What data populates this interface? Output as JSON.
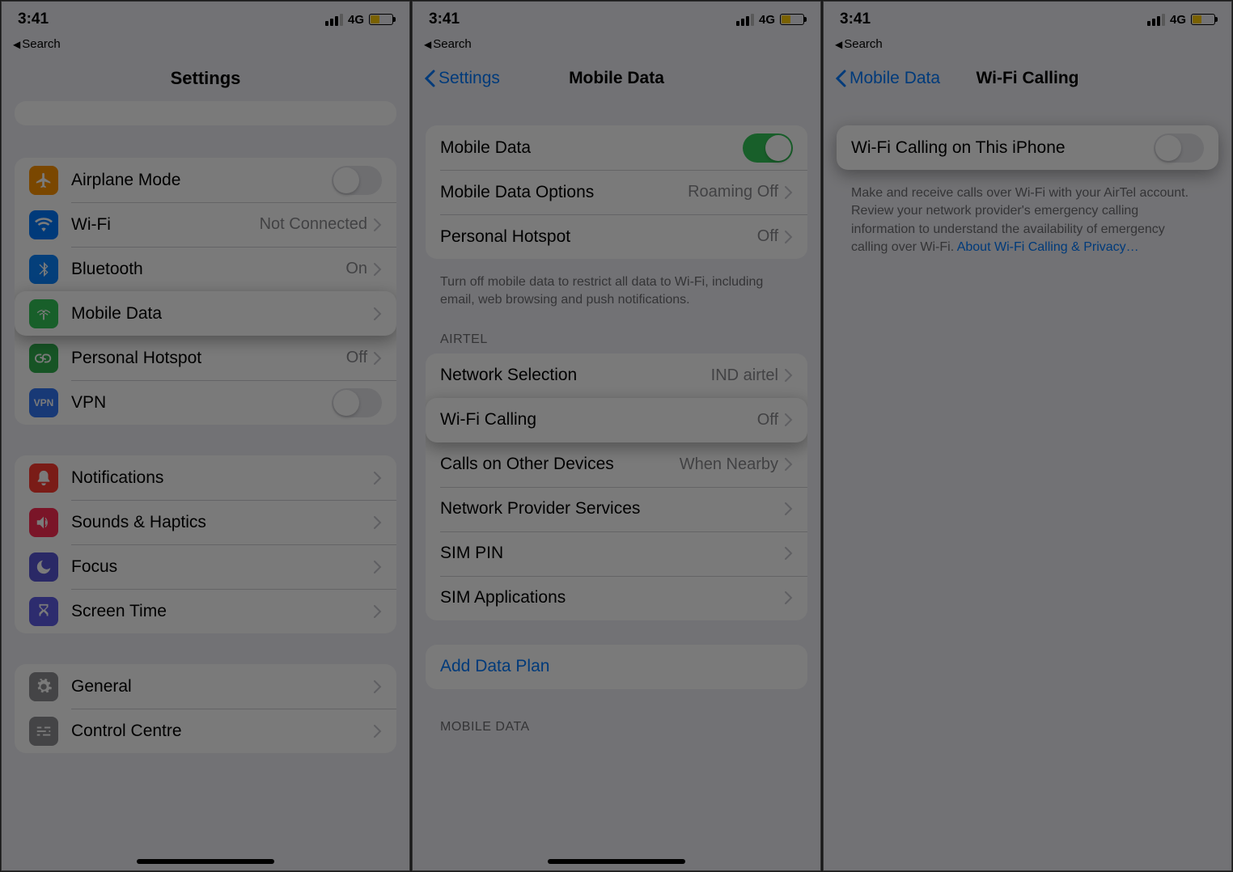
{
  "status": {
    "time": "3:41",
    "network_label": "4G",
    "breadcrumb": "Search"
  },
  "panel1": {
    "title": "Settings",
    "rows": {
      "airplane": "Airplane Mode",
      "wifi": {
        "label": "Wi-Fi",
        "value": "Not Connected"
      },
      "bluetooth": {
        "label": "Bluetooth",
        "value": "On"
      },
      "mobile_data": "Mobile Data",
      "hotspot": {
        "label": "Personal Hotspot",
        "value": "Off"
      },
      "vpn": "VPN",
      "notifications": "Notifications",
      "sounds": "Sounds & Haptics",
      "focus": "Focus",
      "screen_time": "Screen Time",
      "general": "General",
      "control_centre": "Control Centre"
    }
  },
  "panel2": {
    "back": "Settings",
    "title": "Mobile Data",
    "group1": {
      "mobile_data": "Mobile Data",
      "options": {
        "label": "Mobile Data Options",
        "value": "Roaming Off"
      },
      "hotspot": {
        "label": "Personal Hotspot",
        "value": "Off"
      },
      "footer": "Turn off mobile data to restrict all data to Wi-Fi, including email, web browsing and push notifications."
    },
    "carrier_header": "AIRTEL",
    "group2": {
      "network_sel": {
        "label": "Network Selection",
        "value": "IND airtel"
      },
      "wifi_calling": {
        "label": "Wi-Fi Calling",
        "value": "Off"
      },
      "other_devices": {
        "label": "Calls on Other Devices",
        "value": "When Nearby"
      },
      "provider_services": "Network Provider Services",
      "sim_pin": "SIM PIN",
      "sim_apps": "SIM Applications"
    },
    "add_plan": "Add Data Plan",
    "usage_header": "MOBILE DATA"
  },
  "panel3": {
    "back": "Mobile Data",
    "title": "Wi-Fi Calling",
    "row_label": "Wi-Fi Calling on This iPhone",
    "footer_text": "Make and receive calls over Wi-Fi with your AirTel account. Review your network provider's emergency calling information to understand the availability of emergency calling over Wi-Fi. ",
    "footer_link": "About Wi-Fi Calling & Privacy…"
  }
}
